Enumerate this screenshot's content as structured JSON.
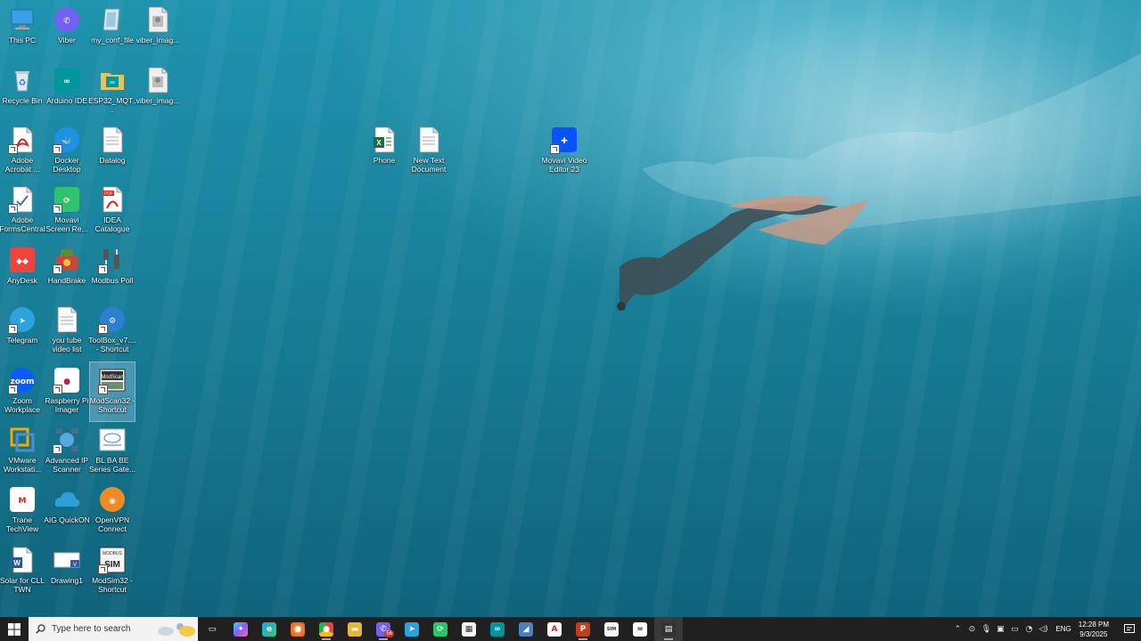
{
  "desktop": {
    "icons": [
      {
        "label": "This PC",
        "shortcut": false,
        "icon": "this-pc-icon"
      },
      {
        "label": "Viber",
        "shortcut": false,
        "icon": "viber-icon"
      },
      {
        "label": "my_conf_file",
        "shortcut": false,
        "icon": "config-file-icon"
      },
      {
        "label": "viber_imag...",
        "shortcut": false,
        "icon": "image-file-icon"
      },
      {
        "label": "Recycle Bin",
        "shortcut": false,
        "icon": "recycle-bin-icon"
      },
      {
        "label": "Arduino IDE",
        "shortcut": false,
        "icon": "arduino-icon"
      },
      {
        "label": "ESP32_MQT...",
        "shortcut": false,
        "icon": "arduino-folder-icon"
      },
      {
        "label": "viber_imag...",
        "shortcut": false,
        "icon": "image-file-icon"
      },
      {
        "label": "Adobe Acrobat ...",
        "shortcut": true,
        "icon": "acrobat-icon"
      },
      {
        "label": "Docker Desktop",
        "shortcut": true,
        "icon": "docker-icon"
      },
      {
        "label": "Datalog",
        "shortcut": false,
        "icon": "text-file-icon"
      },
      {
        "label": "Adobe FormsCentral",
        "shortcut": true,
        "icon": "formscentral-icon"
      },
      {
        "label": "Movavi Screen Re...",
        "shortcut": true,
        "icon": "movavi-screen-icon"
      },
      {
        "label": "IDEA Catalogue",
        "shortcut": false,
        "icon": "pdf-icon"
      },
      {
        "label": "AnyDesk",
        "shortcut": false,
        "icon": "anydesk-icon"
      },
      {
        "label": "HandBrake",
        "shortcut": true,
        "icon": "handbrake-icon"
      },
      {
        "label": "Modbus Poll",
        "shortcut": true,
        "icon": "modbus-poll-icon"
      },
      {
        "label": "Telegram",
        "shortcut": true,
        "icon": "telegram-icon"
      },
      {
        "label": "you tube video list",
        "shortcut": false,
        "icon": "text-file-icon"
      },
      {
        "label": "ToolBox_v7.... - Shortcut",
        "shortcut": true,
        "icon": "gear-icon"
      },
      {
        "label": "Zoom Workplace",
        "shortcut": true,
        "icon": "zoom-icon"
      },
      {
        "label": "Raspberry Pi Imager",
        "shortcut": true,
        "icon": "raspberry-pi-icon"
      },
      {
        "label": "ModScan32 - Shortcut",
        "shortcut": true,
        "icon": "modscan-icon"
      },
      {
        "label": "VMware Workstati...",
        "shortcut": false,
        "icon": "vmware-icon"
      },
      {
        "label": "Advanced IP Scanner",
        "shortcut": true,
        "icon": "ip-scanner-icon"
      },
      {
        "label": "BL BA BE Series Gate...",
        "shortcut": false,
        "icon": "gateway-icon"
      },
      {
        "label": "Trane TechView",
        "shortcut": false,
        "icon": "trane-icon"
      },
      {
        "label": "AIG QuickON",
        "shortcut": false,
        "icon": "cloud-icon"
      },
      {
        "label": "OpenVPN Connect",
        "shortcut": false,
        "icon": "openvpn-icon"
      },
      {
        "label": "Solar for CLL TWN",
        "shortcut": false,
        "icon": "word-doc-icon"
      },
      {
        "label": "Drawing1",
        "shortcut": false,
        "icon": "visio-icon"
      },
      {
        "label": "ModSim32 - Shortcut",
        "shortcut": true,
        "icon": "modsim-icon"
      },
      {
        "label": "Phone",
        "shortcut": false,
        "icon": "excel-icon"
      },
      {
        "label": "New Text Document",
        "shortcut": false,
        "icon": "text-file-icon"
      },
      {
        "label": "Movavi Video Editor 23",
        "shortcut": true,
        "icon": "movavi-video-icon"
      }
    ],
    "selected_icon": "ModScan32 - Shortcut"
  },
  "taskbar": {
    "search_placeholder": "Type here to search",
    "apps": [
      {
        "name": "task-view-icon",
        "running": false
      },
      {
        "name": "copilot-icon",
        "running": false
      },
      {
        "name": "edge-icon",
        "running": false
      },
      {
        "name": "firefox-icon",
        "running": false
      },
      {
        "name": "chrome-icon",
        "running": true
      },
      {
        "name": "file-explorer-icon",
        "running": false
      },
      {
        "name": "viber-icon",
        "running": true,
        "badge": "56"
      },
      {
        "name": "telegram-icon",
        "running": false
      },
      {
        "name": "movavi-icon",
        "running": false
      },
      {
        "name": "microsoft-store-icon",
        "running": false
      },
      {
        "name": "arduino-icon",
        "running": false
      },
      {
        "name": "wireshark-icon",
        "running": false
      },
      {
        "name": "acrobat-icon",
        "running": false
      },
      {
        "name": "powerpoint-icon",
        "running": true
      },
      {
        "name": "modsim-icon",
        "running": false
      },
      {
        "name": "gateway-icon",
        "running": false
      },
      {
        "name": "modscan-icon",
        "running": true,
        "active": true
      }
    ],
    "tray": {
      "language": "ENG",
      "time": "12:28 PM",
      "date": "9/3/2025"
    }
  },
  "colors": {
    "taskbar_bg": "#202020",
    "water_top": "#1f93ad",
    "water_bottom": "#0f627a"
  }
}
